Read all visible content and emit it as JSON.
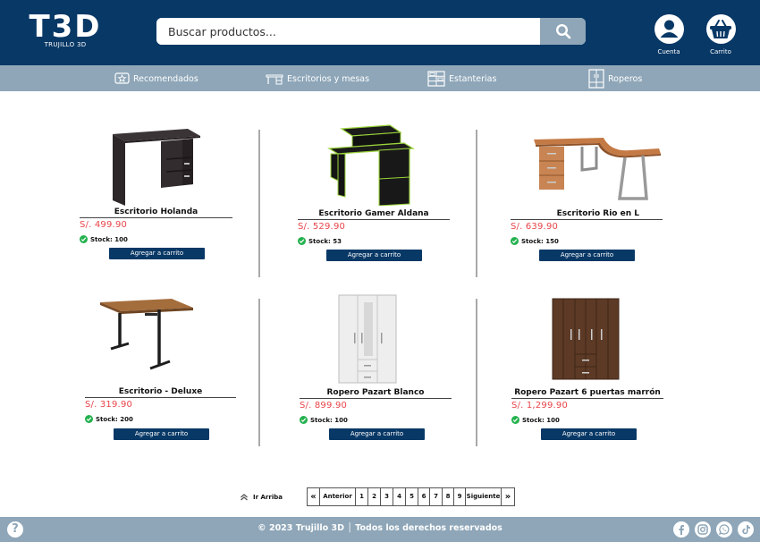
{
  "brand": {
    "logo_text": "T3D",
    "logo_subtitle": "TRUJILLO 3D"
  },
  "search": {
    "placeholder": "Buscar productos..."
  },
  "header_actions": {
    "account_label": "Cuenta",
    "cart_label": "Carrito"
  },
  "nav": {
    "items": [
      {
        "label": "Recomendados",
        "icon": "star-badge-icon"
      },
      {
        "label": "Escritorios y mesas",
        "icon": "desk-icon"
      },
      {
        "label": "Estanterias",
        "icon": "shelf-icon"
      },
      {
        "label": "Roperos",
        "icon": "wardrobe-icon"
      }
    ]
  },
  "products": [
    {
      "name": "Escritorio Holanda",
      "price": "S/. 499.90",
      "stock": "Stock: 100",
      "button": "Agregar a carrito"
    },
    {
      "name": "Escritorio Gamer Aldana",
      "price": "S/. 529.90",
      "stock": "Stock: 53",
      "button": "Agregar a carrito"
    },
    {
      "name": "Escritorio Rio en L",
      "price": "S/. 639.90",
      "stock": "Stock: 150",
      "button": "Agregar a carrito"
    },
    {
      "name": "Escritorio - Deluxe",
      "price": "S/. 319.90",
      "stock": "Stock: 200",
      "button": "Agregar a carrito"
    },
    {
      "name": "Ropero Pazart Blanco",
      "price": "S/. 899.90",
      "stock": "Stock: 100",
      "button": "Agregar a carrito"
    },
    {
      "name": "Ropero Pazart 6 puertas marrón",
      "price": "S/. 1,299.90",
      "stock": "Stock: 100",
      "button": "Agregar a carrito"
    }
  ],
  "pagination": {
    "go_top": "Ir Arriba",
    "first": "«",
    "prev": "Anterior",
    "pages": [
      "1",
      "2",
      "3",
      "4",
      "5",
      "6",
      "7",
      "8",
      "9"
    ],
    "next": "Siguiente",
    "last": "»"
  },
  "footer": {
    "help": "?",
    "copyright": "© 2023 Trujillo 3D │ Todos los derechos reservados",
    "social": [
      "facebook-icon",
      "instagram-icon",
      "whatsapp-icon",
      "tiktok-icon"
    ]
  },
  "colors": {
    "primary": "#083866",
    "secondary": "#8ea6b8",
    "price": "#e8454a",
    "in_stock": "#23b14d"
  }
}
